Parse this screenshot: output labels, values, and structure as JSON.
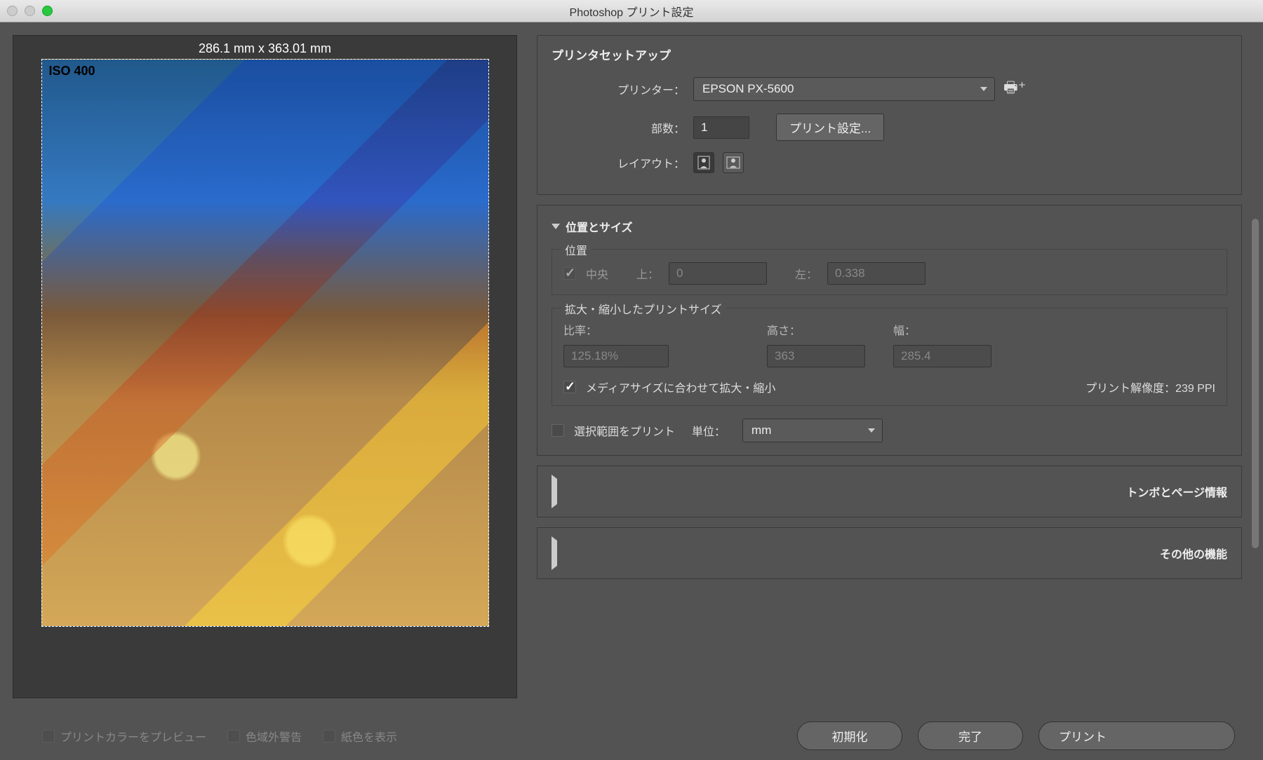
{
  "title": "Photoshop プリント設定",
  "preview": {
    "dimensions": "286.1 mm x 363.01 mm",
    "iso": "ISO 400"
  },
  "leftChecks": {
    "previewColor": "プリントカラーをプレビュー",
    "gamut": "色域外警告",
    "paperWhite": "紙色を表示"
  },
  "setup": {
    "heading": "プリンタセットアップ",
    "printerLabel": "プリンター：",
    "printerValue": "EPSON PX-5600",
    "copiesLabel": "部数：",
    "copiesValue": "1",
    "printSettingsBtn": "プリント設定...",
    "layoutLabel": "レイアウト："
  },
  "pos": {
    "heading": "位置とサイズ",
    "positionLegend": "位置",
    "centerLabel": "中央",
    "topLabel": "上：",
    "topValue": "0",
    "leftLabel": "左：",
    "leftValue": "0.338",
    "scaleLegend": "拡大・縮小したプリントサイズ",
    "ratioLabel": "比率：",
    "ratioValue": "125.18%",
    "heightLabel": "高さ：",
    "heightValue": "363",
    "widthLabel": "幅：",
    "widthValue": "285.4",
    "fitMediaLabel": "メディアサイズに合わせて拡大・縮小",
    "resolutionLabel": "プリント解像度：239 PPI",
    "printSelectionLabel": "選択範囲をプリント",
    "unitsLabel": "単位：",
    "unitsValue": "mm"
  },
  "sections": {
    "marks": "トンボとページ情報",
    "other": "その他の機能"
  },
  "footer": {
    "reset": "初期化",
    "done": "完了",
    "print": "プリント"
  }
}
